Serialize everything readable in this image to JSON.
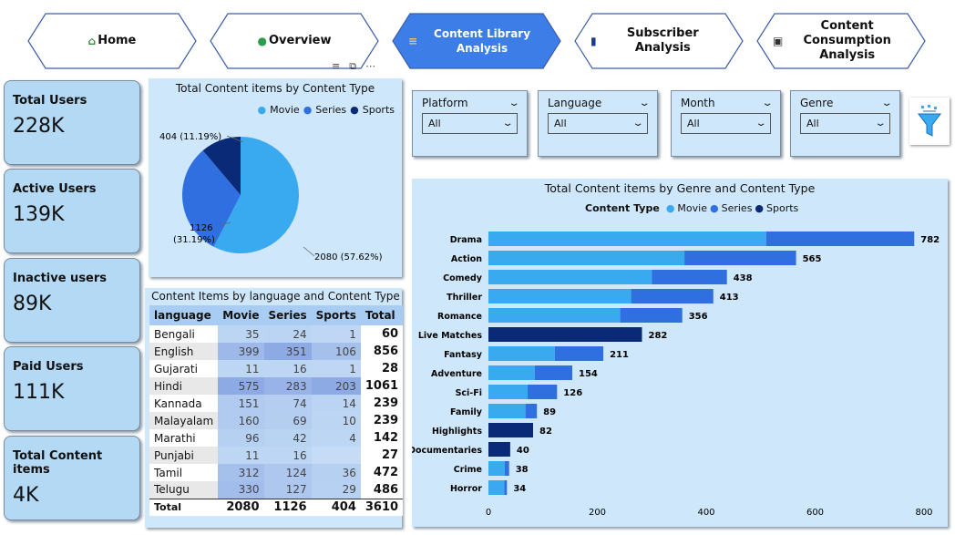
{
  "nav": [
    {
      "label": "Home",
      "icon": "home-icon",
      "active": false
    },
    {
      "label": "Overview",
      "icon": "globe-icon",
      "active": false
    },
    {
      "label": "Content Library Analysis",
      "icon": "scroll-icon",
      "active": true
    },
    {
      "label": "Subscriber Analysis",
      "icon": "phone-icon",
      "active": false
    },
    {
      "label": "Content Consumption Analysis",
      "icon": "media-icon",
      "active": false
    }
  ],
  "kpis": [
    {
      "title": "Total Users",
      "value": "228K"
    },
    {
      "title": "Active Users",
      "value": "139K"
    },
    {
      "title": "Inactive users",
      "value": "89K"
    },
    {
      "title": "Paid Users",
      "value": "111K"
    },
    {
      "title": "Total Content items",
      "value": "4K"
    }
  ],
  "slicers": [
    {
      "label": "Platform",
      "value": "All"
    },
    {
      "label": "Language",
      "value": "All"
    },
    {
      "label": "Month",
      "value": "All"
    },
    {
      "label": "Genre",
      "value": "All"
    }
  ],
  "colors": {
    "movie": "#3aaaf0",
    "series": "#2f6fe0",
    "sports": "#0a2a78",
    "panel": "#cfe7fa",
    "nav_active": "#3d7de8"
  },
  "pie": {
    "title": "Total Content items by Content Type",
    "legend": [
      "Movie",
      "Series",
      "Sports"
    ],
    "labels": [
      "2080 (57.62%)",
      "1126",
      "(31.19%)",
      "404 (11.19%)"
    ]
  },
  "table": {
    "title": "Content Items by language and Content Type",
    "headers": [
      "language",
      "Movie",
      "Series",
      "Sports",
      "Total"
    ],
    "rows": [
      [
        "Bengali",
        "35",
        "24",
        "1",
        "60"
      ],
      [
        "English",
        "399",
        "351",
        "106",
        "856"
      ],
      [
        "Gujarati",
        "11",
        "16",
        "1",
        "28"
      ],
      [
        "Hindi",
        "575",
        "283",
        "203",
        "1061"
      ],
      [
        "Kannada",
        "151",
        "74",
        "14",
        "239"
      ],
      [
        "Malayalam",
        "160",
        "69",
        "10",
        "239"
      ],
      [
        "Marathi",
        "96",
        "42",
        "4",
        "142"
      ],
      [
        "Punjabi",
        "11",
        "16",
        "",
        "27"
      ],
      [
        "Tamil",
        "312",
        "124",
        "36",
        "472"
      ],
      [
        "Telugu",
        "330",
        "127",
        "29",
        "486"
      ]
    ],
    "total": [
      "Total",
      "2080",
      "1126",
      "404",
      "3610"
    ]
  },
  "bar": {
    "title": "Total Content items by Genre and Content Type",
    "legend_title": "Content Type",
    "legend": [
      "Movie",
      "Series",
      "Sports"
    ]
  },
  "chart_data": [
    {
      "type": "pie",
      "title": "Total Content items by Content Type",
      "categories": [
        "Movie",
        "Series",
        "Sports"
      ],
      "values": [
        2080,
        1126,
        404
      ],
      "percents": [
        57.62,
        31.19,
        11.19
      ],
      "legend": "top-right"
    },
    {
      "type": "bar",
      "orientation": "horizontal",
      "stacked": true,
      "title": "Total Content items by Genre and Content Type",
      "categories": [
        "Drama",
        "Action",
        "Comedy",
        "Thriller",
        "Romance",
        "Live Matches",
        "Fantasy",
        "Adventure",
        "Sci-Fi",
        "Family",
        "Highlights",
        "Documentaries",
        "Crime",
        "Horror"
      ],
      "series": [
        {
          "name": "Movie",
          "values": [
            510,
            360,
            300,
            262,
            242,
            0,
            122,
            85,
            72,
            68,
            0,
            0,
            30,
            29
          ]
        },
        {
          "name": "Series",
          "values": [
            272,
            205,
            138,
            151,
            114,
            0,
            89,
            69,
            54,
            21,
            0,
            0,
            8,
            5
          ]
        },
        {
          "name": "Sports",
          "values": [
            0,
            0,
            0,
            0,
            0,
            282,
            0,
            0,
            0,
            0,
            82,
            40,
            0,
            0
          ]
        }
      ],
      "totals": [
        782,
        565,
        438,
        413,
        356,
        282,
        211,
        154,
        126,
        89,
        82,
        40,
        38,
        34
      ],
      "xticks": [
        0,
        200,
        400,
        600,
        800
      ],
      "xlim": [
        0,
        800
      ],
      "legend": "top"
    }
  ]
}
